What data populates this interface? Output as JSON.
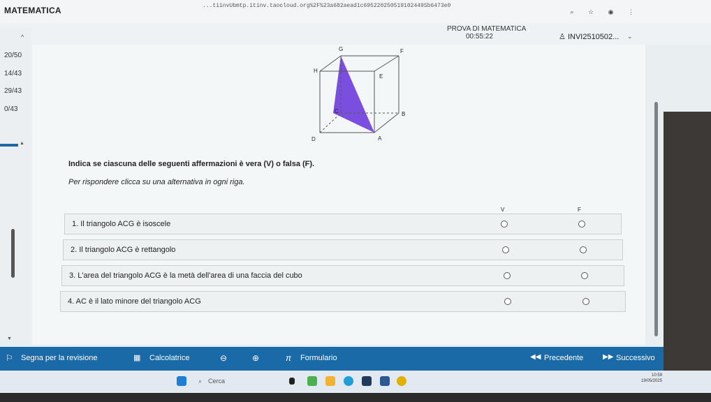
{
  "app": {
    "title": "MATEMATICA",
    "url": "...tiinvUbmtp.itinv.taocloud.org%2F%23a682aead1c695220250519102449Sb6473e0"
  },
  "exam": {
    "title": "PROVA DI MATEMATICA",
    "timer": "00:55:22",
    "user": "INVI2510502..."
  },
  "sidebar": {
    "items": [
      "20/50",
      "14/43",
      "29/43",
      "0/43"
    ]
  },
  "cube_labels": {
    "G": "G",
    "F": "F",
    "H": "H",
    "E": "E",
    "C": "C",
    "B": "B",
    "D": "D",
    "A": "A"
  },
  "question": {
    "instruction": "Indica se ciascuna delle seguenti affermazioni è vera (V) o falsa (F).",
    "hint": "Per rispondere clicca su una alternativa in ogni riga.",
    "col_v": "V",
    "col_f": "F",
    "rows": [
      "1. Il triangolo ACG è isoscele",
      "2. Il triangolo ACG è rettangolo",
      "3. L'area del triangolo ACG è la metà dell'area di una faccia del cubo",
      "4. AC è il lato minore del triangolo ACG"
    ]
  },
  "footer": {
    "review": "Segna per la revisione",
    "calculator": "Calcolatrice",
    "formulary": "Formulario",
    "previous": "Precedente",
    "next": "Successivo"
  },
  "taskbar": {
    "search_placeholder": "Cerca",
    "time": "10:59",
    "date": "19/05/2025"
  },
  "colors": {
    "accent": "#1b6aa8",
    "triangle": "#7a4fe0"
  }
}
